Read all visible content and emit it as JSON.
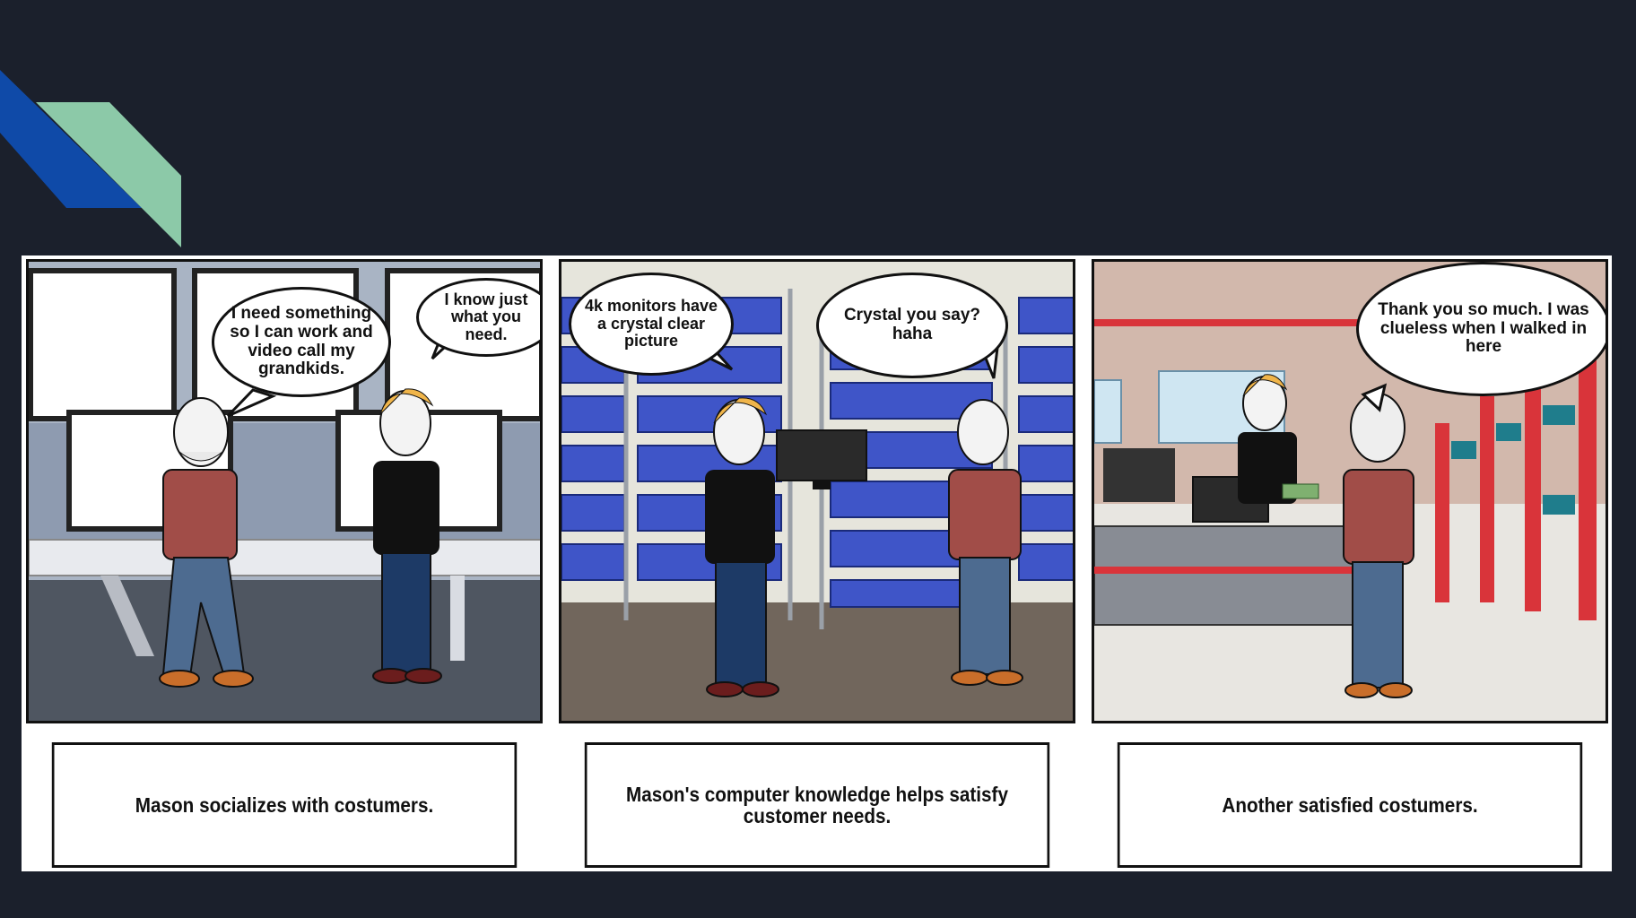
{
  "panels": [
    {
      "bubbles": [
        "I need something so I can work and video call my grandkids.",
        "I know just what you need."
      ],
      "caption": "Mason socializes with costumers."
    },
    {
      "bubbles": [
        "4k monitors have a crystal clear picture",
        "Crystal you say? haha"
      ],
      "caption": "Mason's computer knowledge helps satisfy customer needs."
    },
    {
      "bubbles": [
        "Thank you so much. I was clueless when I walked in here"
      ],
      "caption": "Another satisfied costumers."
    }
  ],
  "colors": {
    "background": "#1b202c",
    "accent_blue": "#0f4aa8",
    "accent_green": "#8cc9a8"
  }
}
